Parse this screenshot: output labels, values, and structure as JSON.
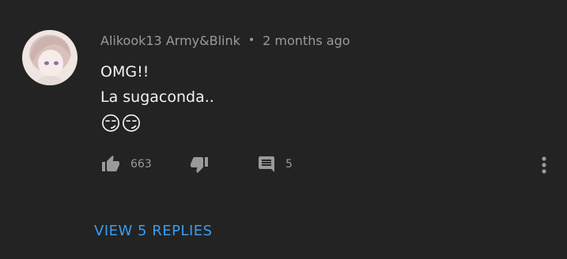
{
  "comment": {
    "author": "Alikook13 Army&Blink",
    "separator": "•",
    "timestamp": "2 months ago",
    "lines": [
      "OMG!!",
      "La sugaconda.."
    ],
    "emoji": "😏😏"
  },
  "actions": {
    "like_icon": "thumbs-up-icon",
    "like_count": "663",
    "dislike_icon": "thumbs-down-icon",
    "reply_icon": "comment-icon",
    "reply_count": "5",
    "more_icon": "more-vertical-icon"
  },
  "view_replies_label": "VIEW 5 REPLIES",
  "colors": {
    "background": "#232323",
    "text_primary": "#f2f2f2",
    "text_secondary": "#9a9a9a",
    "link": "#3b9cf0"
  }
}
